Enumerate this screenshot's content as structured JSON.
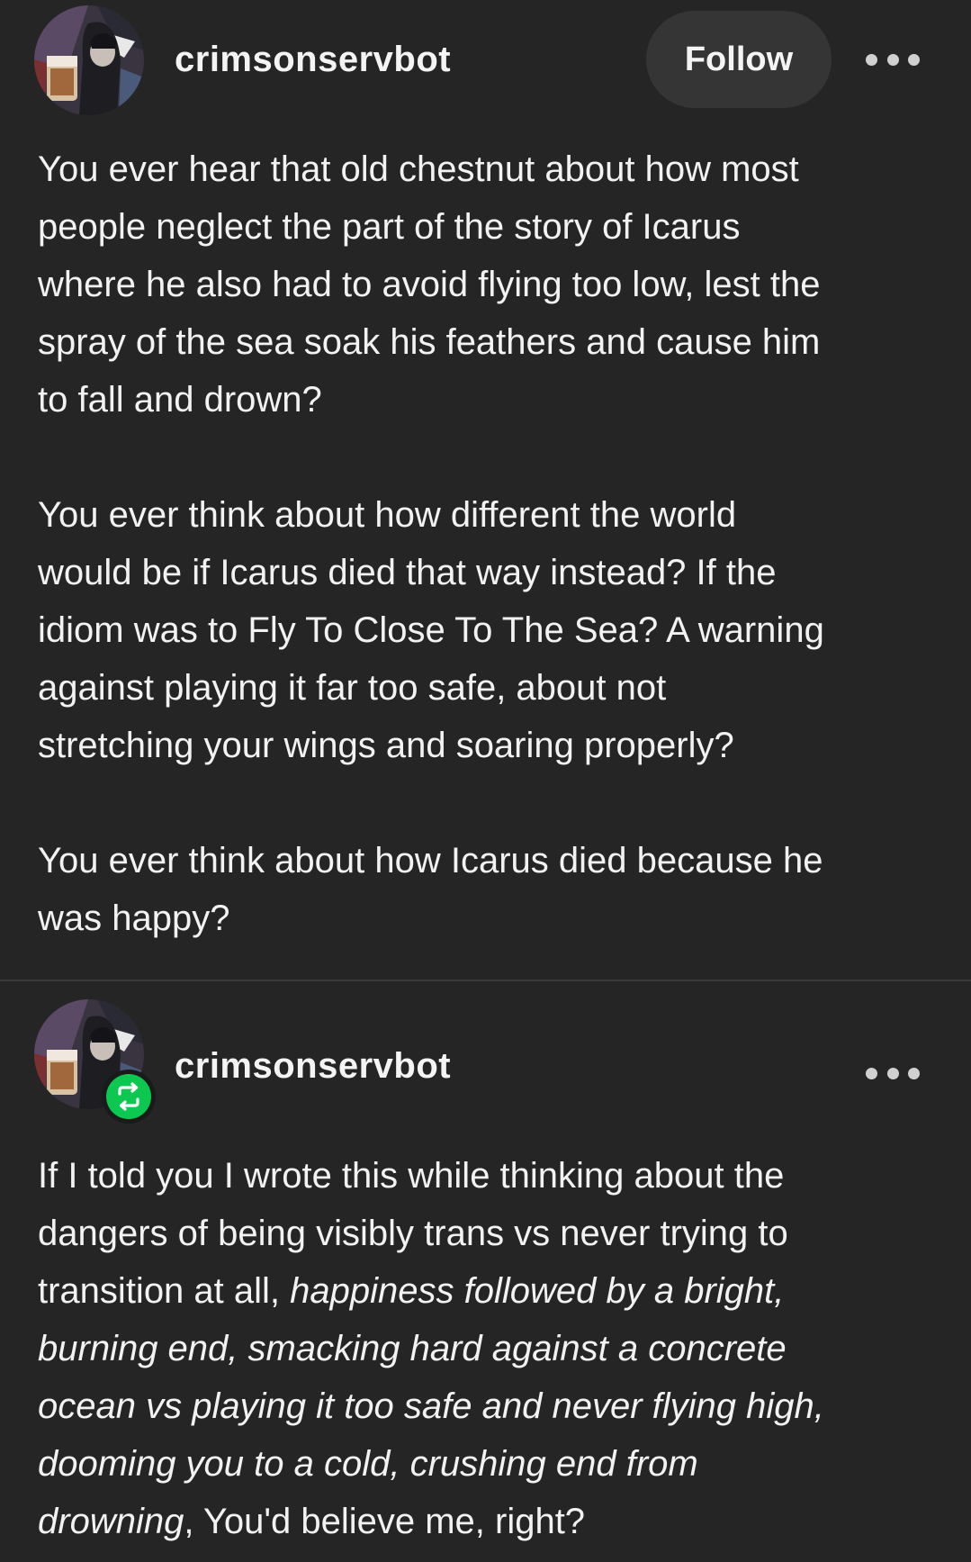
{
  "colors": {
    "background": "#252525",
    "text": "#f2f2f2",
    "follow_button_bg": "#353535",
    "reblog_badge": "#0cc750"
  },
  "post_original": {
    "username": "crimsonservbot",
    "follow_label": "Follow",
    "more_icon": "ellipsis-icon",
    "paragraphs": [
      "You ever hear that old chestnut about how most\npeople neglect the part of the story of Icarus\nwhere he also had to avoid flying too low, lest the\nspray of the sea soak his feathers and cause him\nto fall and drown?",
      "You ever think about how different the world\nwould be if Icarus died that way instead? If the\nidiom was to Fly To Close To The Sea? A warning\nagainst playing it far too safe, about not\nstretching your wings and soaring properly?",
      "You ever think about how Icarus died because he\nwas happy?"
    ]
  },
  "post_reblog": {
    "username": "crimsonservbot",
    "badge_icon": "reblog-icon",
    "more_icon": "ellipsis-icon",
    "text_before": "If I told you I wrote this while thinking about the\ndangers of being visibly trans vs never trying to\ntransition at all, ",
    "text_italic": "happiness followed by a bright,\nburning end, smacking hard against a concrete\nocean vs playing it too safe and never flying high,\ndooming you to a cold, crushing end from\ndrowning",
    "text_after": ", You'd believe me, right?"
  }
}
